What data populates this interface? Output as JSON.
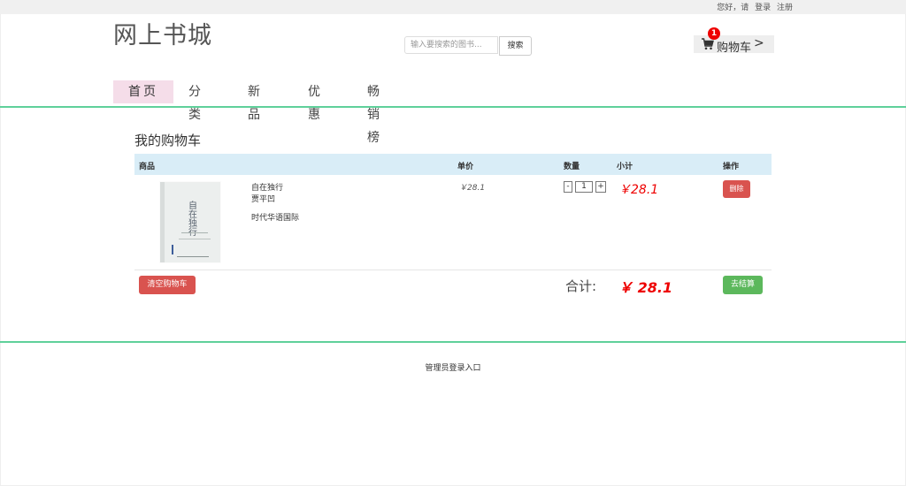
{
  "topbar": {
    "greeting": "您好，请",
    "login": "登录",
    "register": "注册"
  },
  "header": {
    "logo": "网上书城",
    "search": {
      "placeholder": "输入要搜索的图书...",
      "button": "搜索"
    },
    "cart": {
      "label": "购物车",
      "badge_count": "1",
      "chevron": ">"
    }
  },
  "nav": {
    "items": [
      "首页",
      "分类",
      "新品",
      "优惠",
      "畅销榜"
    ],
    "active_index": 0
  },
  "cart_page": {
    "title": "我的购物车",
    "columns": {
      "product": "商品",
      "unit_price": "单价",
      "quantity": "数量",
      "subtotal": "小计",
      "action": "操作"
    },
    "items": [
      {
        "cover_title": "自在独行",
        "title": "自在独行",
        "author": "贾平凹",
        "publisher": "时代华语国际",
        "unit_price": "￥28.1",
        "qty_minus": "-",
        "quantity": "1",
        "qty_plus": "+",
        "subtotal": "￥28.1",
        "delete_label": "删除"
      }
    ],
    "clear_label": "清空购物车",
    "total_label": "合计:",
    "total_value": "￥ 28.1",
    "checkout_label": "去结算"
  },
  "footer": {
    "admin_link": "管理员登录入口"
  },
  "colors": {
    "accent_green": "#5fd09a",
    "danger": "#d9534f",
    "success": "#5cb85c",
    "price_red": "#ee0000",
    "table_head": "#d9edf7",
    "nav_active": "#f5dde9"
  }
}
